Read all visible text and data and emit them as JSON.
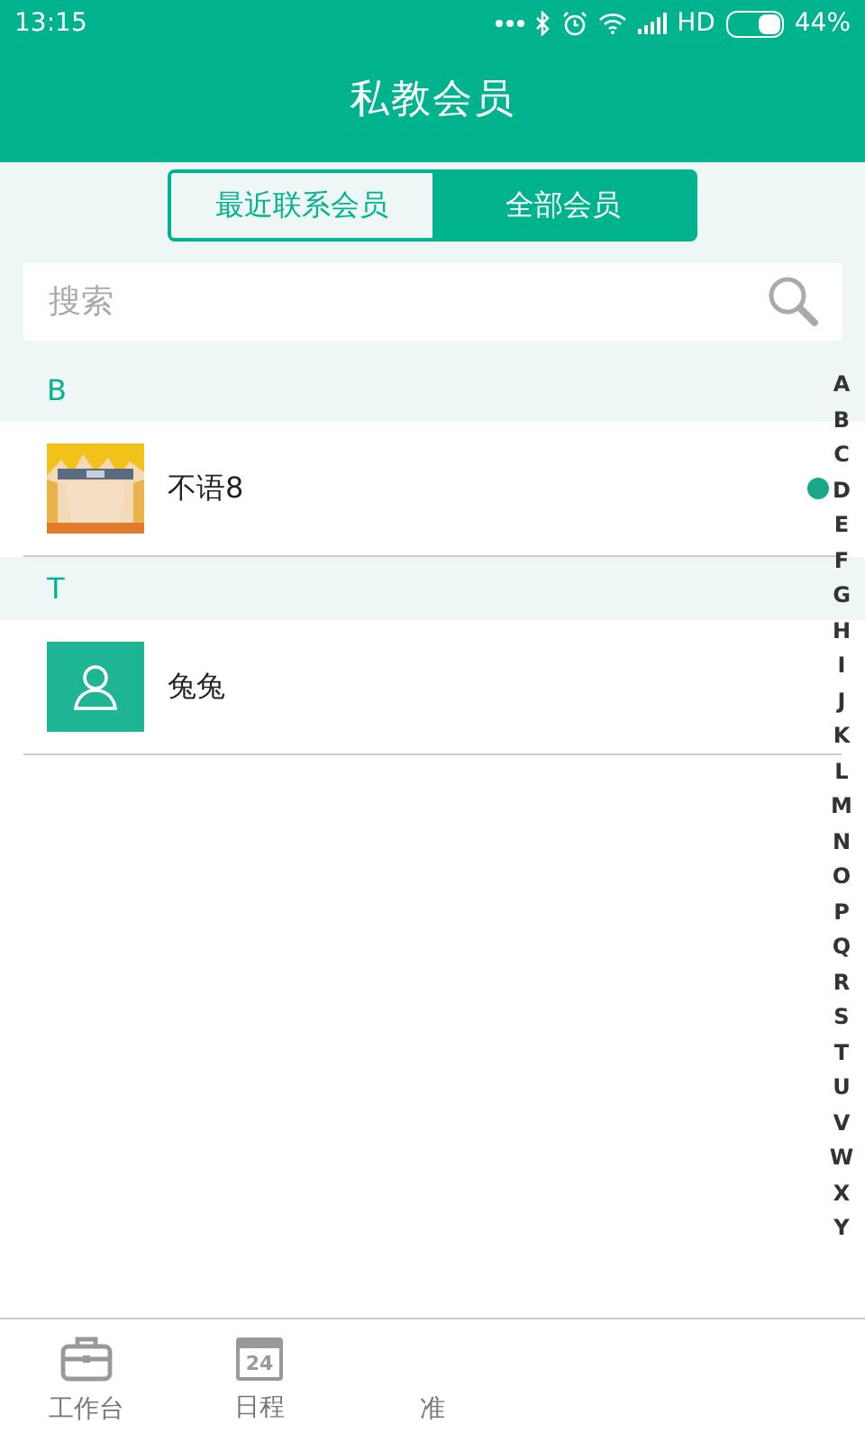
{
  "status_bar": {
    "time": "13:15",
    "network": "HD",
    "battery": "44%"
  },
  "header": {
    "title": "私教会员"
  },
  "tabs": [
    {
      "label": "最近联系会员",
      "selected": false
    },
    {
      "label": "全部会员",
      "selected": true
    }
  ],
  "search": {
    "placeholder": "搜索"
  },
  "sections": [
    {
      "letter": "B",
      "members": [
        {
          "name": "不语8",
          "kind": "picture",
          "online": true
        }
      ]
    },
    {
      "letter": "T",
      "members": [
        {
          "name": "兔兔",
          "kind": "placeholder",
          "online": false
        }
      ]
    }
  ],
  "index": [
    "A",
    "B",
    "C",
    "D",
    "E",
    "F",
    "G",
    "H",
    "I",
    "J",
    "K",
    "L",
    "M",
    "N",
    "O",
    "P",
    "Q",
    "R",
    "S",
    "T",
    "U",
    "V",
    "W",
    "X",
    "Y"
  ],
  "nav": [
    {
      "label": "工作台",
      "kind": "briefcase"
    },
    {
      "label": "日程",
      "kind": "calendar",
      "day": "24"
    },
    {
      "label": "准",
      "kind": "hidden"
    }
  ]
}
